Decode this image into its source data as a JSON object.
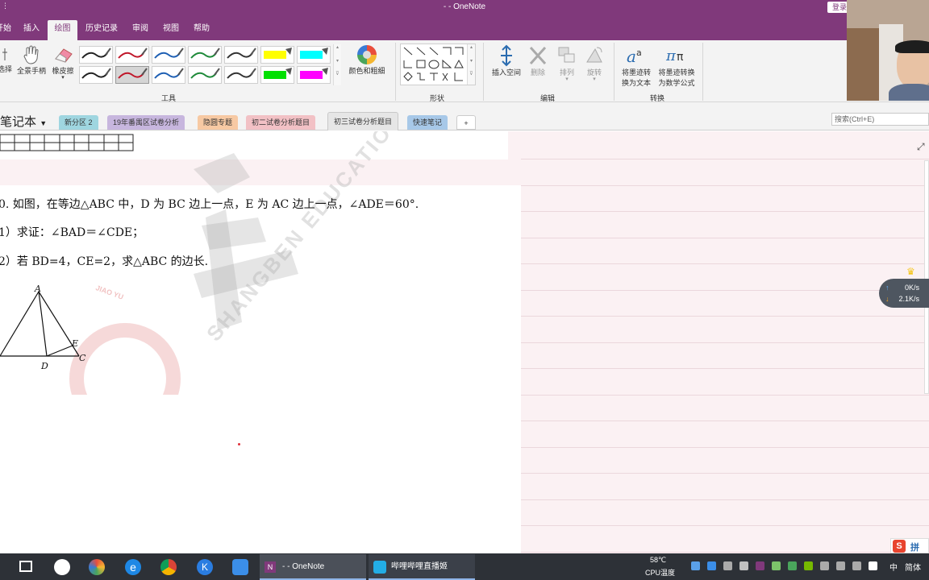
{
  "window": {
    "title": "- - OneNote",
    "login_label": "登录"
  },
  "menu": {
    "tabs": [
      "开始",
      "插入",
      "绘图",
      "历史记录",
      "审阅",
      "视图",
      "帮助"
    ],
    "active": "绘图"
  },
  "ribbon": {
    "select_label": "选择",
    "hand_label": "全景手柄",
    "eraser_label": "橡皮擦",
    "color_label": "颜色和粗细",
    "tools_group": "工具",
    "shapes_group": "形状",
    "insert_space_label": "插入空间",
    "delete_label": "删除",
    "arrange_label": "排列",
    "rotate_label": "旋转",
    "edit_group": "编辑",
    "ink_to_text_label_1": "将墨迹转",
    "ink_to_text_label_2": "换为文本",
    "ink_to_math_label_1": "将墨迹转换",
    "ink_to_math_label_2": "为数学公式",
    "convert_group": "转换",
    "pen_colors": [
      "#222222",
      "#c0172a",
      "#1e5fb3",
      "#1f8a3a",
      "#333333",
      "#ffff00",
      "#00ffff",
      "#222222",
      "#c0172a",
      "#1e5fb3",
      "#1f8a3a",
      "#333333",
      "#00e000",
      "#ff00ff"
    ]
  },
  "sections": {
    "notebook": "笔记本",
    "tabs": [
      {
        "label": "新分区 2",
        "color": "#9fd6e0"
      },
      {
        "label": "19年番禺区试卷分析",
        "color": "#c7b6de"
      },
      {
        "label": "隐圆专题",
        "color": "#f7c9a3"
      },
      {
        "label": "初二试卷分析题目",
        "color": "#f2c1c5"
      },
      {
        "label": "初三试卷分析题目",
        "color": "#e6e6e6"
      },
      {
        "label": "快速笔记",
        "color": "#a7c8e8"
      }
    ],
    "add_label": "+",
    "search_placeholder": "搜索(Ctrl+E)"
  },
  "content": {
    "line1": "0. 如图，在等边△ABC 中，D 为 BC 边上一点，E 为 AC 边上一点，∠ADE＝60°.",
    "line2": "1）求证：∠BAD＝∠CDE；",
    "line3": "2）若 BD=4，CE=2，求△ABC 的边长.",
    "point_a": "A",
    "point_d": "D",
    "point_e": "E",
    "point_c": "C",
    "watermark_en": "SHANGBEN EDUCATION",
    "watermark_small": "JIAO YU"
  },
  "overlay": {
    "upload_speed": "0K/s",
    "download_speed": "2.1K/s"
  },
  "taskbar": {
    "apps": [
      {
        "label": "- - OneNote"
      },
      {
        "label": "哔哩哔哩直播姬"
      }
    ],
    "temp": "58℃",
    "cpu_label": "CPU温度",
    "ime1": "中",
    "ime2": "简体",
    "sogou": "拼"
  }
}
